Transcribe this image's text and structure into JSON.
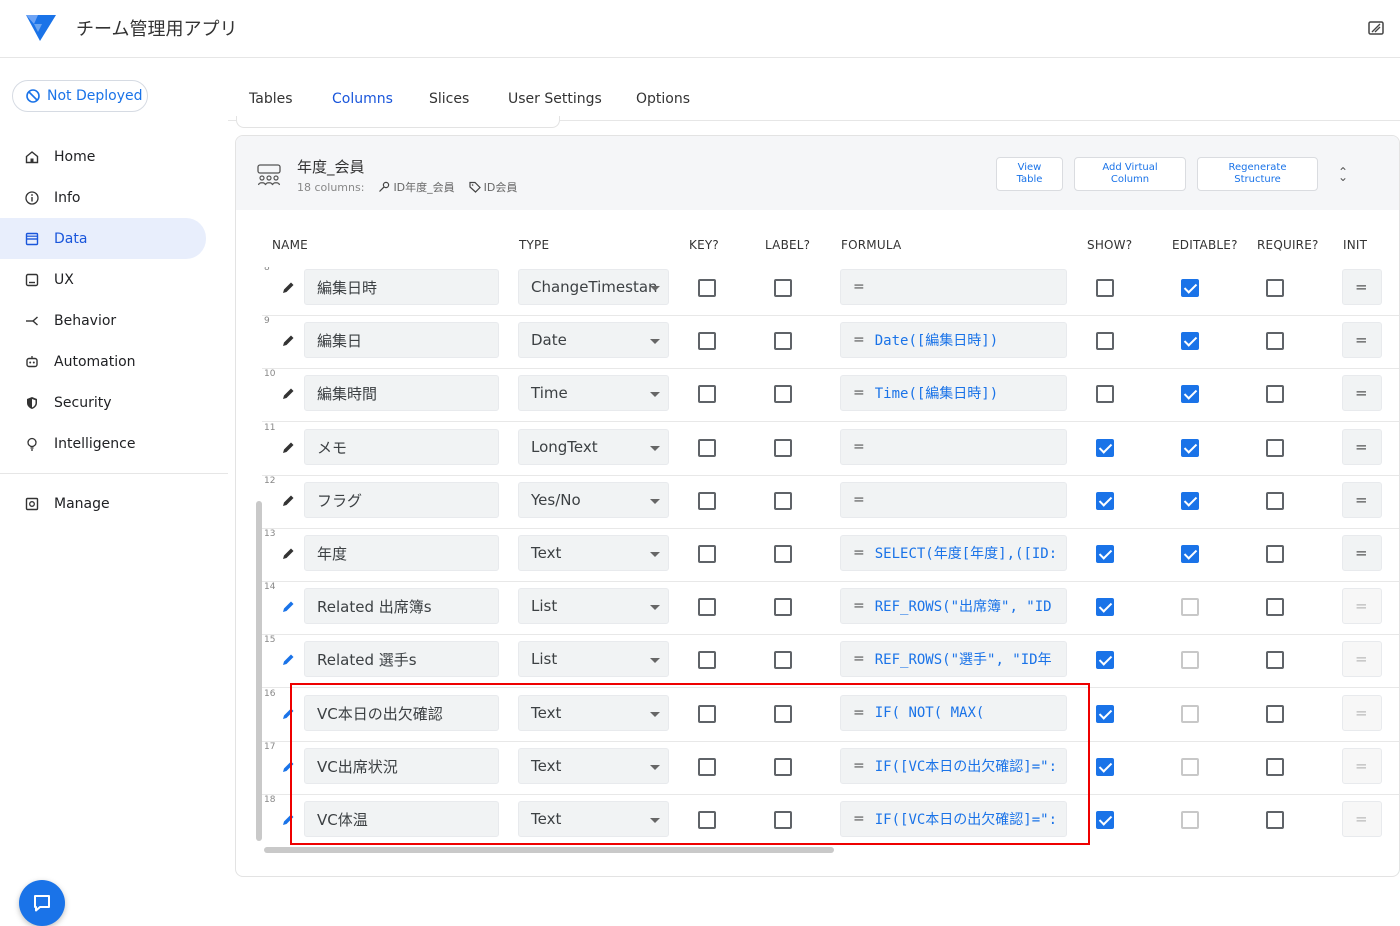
{
  "app": {
    "title": "チーム管理用アプリ",
    "brand_color": "#1a73e8"
  },
  "deploy": {
    "label": "Not Deployed"
  },
  "nav": {
    "items": [
      {
        "label": "Home",
        "icon": "home-icon"
      },
      {
        "label": "Info",
        "icon": "info-icon"
      },
      {
        "label": "Data",
        "icon": "data-icon",
        "active": true
      },
      {
        "label": "UX",
        "icon": "ux-icon"
      },
      {
        "label": "Behavior",
        "icon": "behavior-icon"
      },
      {
        "label": "Automation",
        "icon": "automation-icon"
      },
      {
        "label": "Security",
        "icon": "security-icon"
      },
      {
        "label": "Intelligence",
        "icon": "intelligence-icon"
      }
    ],
    "manage": {
      "label": "Manage",
      "icon": "manage-icon"
    }
  },
  "tabs": [
    {
      "label": "Tables"
    },
    {
      "label": "Columns",
      "active": true
    },
    {
      "label": "Slices"
    },
    {
      "label": "User Settings"
    },
    {
      "label": "Options"
    }
  ],
  "table": {
    "name": "年度_会員",
    "columns_count": "18 columns:",
    "key": "ID年度_会員",
    "label": "ID会員",
    "buttons": {
      "view_table_1": "View",
      "view_table_2": "Table",
      "add_virtual_1": "Add Virtual",
      "add_virtual_2": "Column",
      "regenerate_1": "Regenerate",
      "regenerate_2": "Structure"
    }
  },
  "headers": {
    "name": "NAME",
    "type": "TYPE",
    "key": "KEY?",
    "label": "LABEL?",
    "formula": "FORMULA",
    "show": "SHOW?",
    "editable": "EDITABLE?",
    "require": "REQUIRE?",
    "init": "INIT"
  },
  "rows": [
    {
      "num": "8",
      "name": "編集日時",
      "type": "ChangeTimestan",
      "formula": "",
      "show": false,
      "editable": true,
      "editable_disabled": false,
      "require": false
    },
    {
      "num": "9",
      "name": "編集日",
      "type": "Date",
      "formula": "Date([編集日時])",
      "show": false,
      "editable": true,
      "editable_disabled": false,
      "require": false
    },
    {
      "num": "10",
      "name": "編集時間",
      "type": "Time",
      "formula": "Time([編集日時])",
      "show": false,
      "editable": true,
      "editable_disabled": false,
      "require": false
    },
    {
      "num": "11",
      "name": "メモ",
      "type": "LongText",
      "formula": "",
      "show": true,
      "editable": true,
      "editable_disabled": false,
      "require": false
    },
    {
      "num": "12",
      "name": "フラグ",
      "type": "Yes/No",
      "formula": "",
      "show": true,
      "editable": true,
      "editable_disabled": false,
      "require": false
    },
    {
      "num": "13",
      "name": "年度",
      "type": "Text",
      "formula": "SELECT(年度[年度],([ID:",
      "show": true,
      "editable": true,
      "editable_disabled": false,
      "require": false
    },
    {
      "num": "14",
      "name": "Related 出席簿s",
      "type": "List",
      "formula": "REF_ROWS(\"出席簿\", \"ID",
      "show": true,
      "editable": false,
      "editable_disabled": true,
      "require": false
    },
    {
      "num": "15",
      "name": "Related 選手s",
      "type": "List",
      "formula": "REF_ROWS(\"選手\", \"ID年",
      "show": true,
      "editable": false,
      "editable_disabled": true,
      "require": false
    },
    {
      "num": "16",
      "name": "VC本日の出欠確認",
      "type": "Text",
      "formula": "IF(   NOT(     MAX(",
      "show": true,
      "editable": false,
      "editable_disabled": true,
      "require": false
    },
    {
      "num": "17",
      "name": "VC出席状況",
      "type": "Text",
      "formula": "IF([VC本日の出欠確認]=\":",
      "show": true,
      "editable": false,
      "editable_disabled": true,
      "require": false
    },
    {
      "num": "18",
      "name": "VC体温",
      "type": "Text",
      "formula": "IF([VC本日の出欠確認]=\":",
      "show": true,
      "editable": false,
      "editable_disabled": true,
      "require": false
    }
  ],
  "formula_prefix": "=",
  "init_prefix": "="
}
